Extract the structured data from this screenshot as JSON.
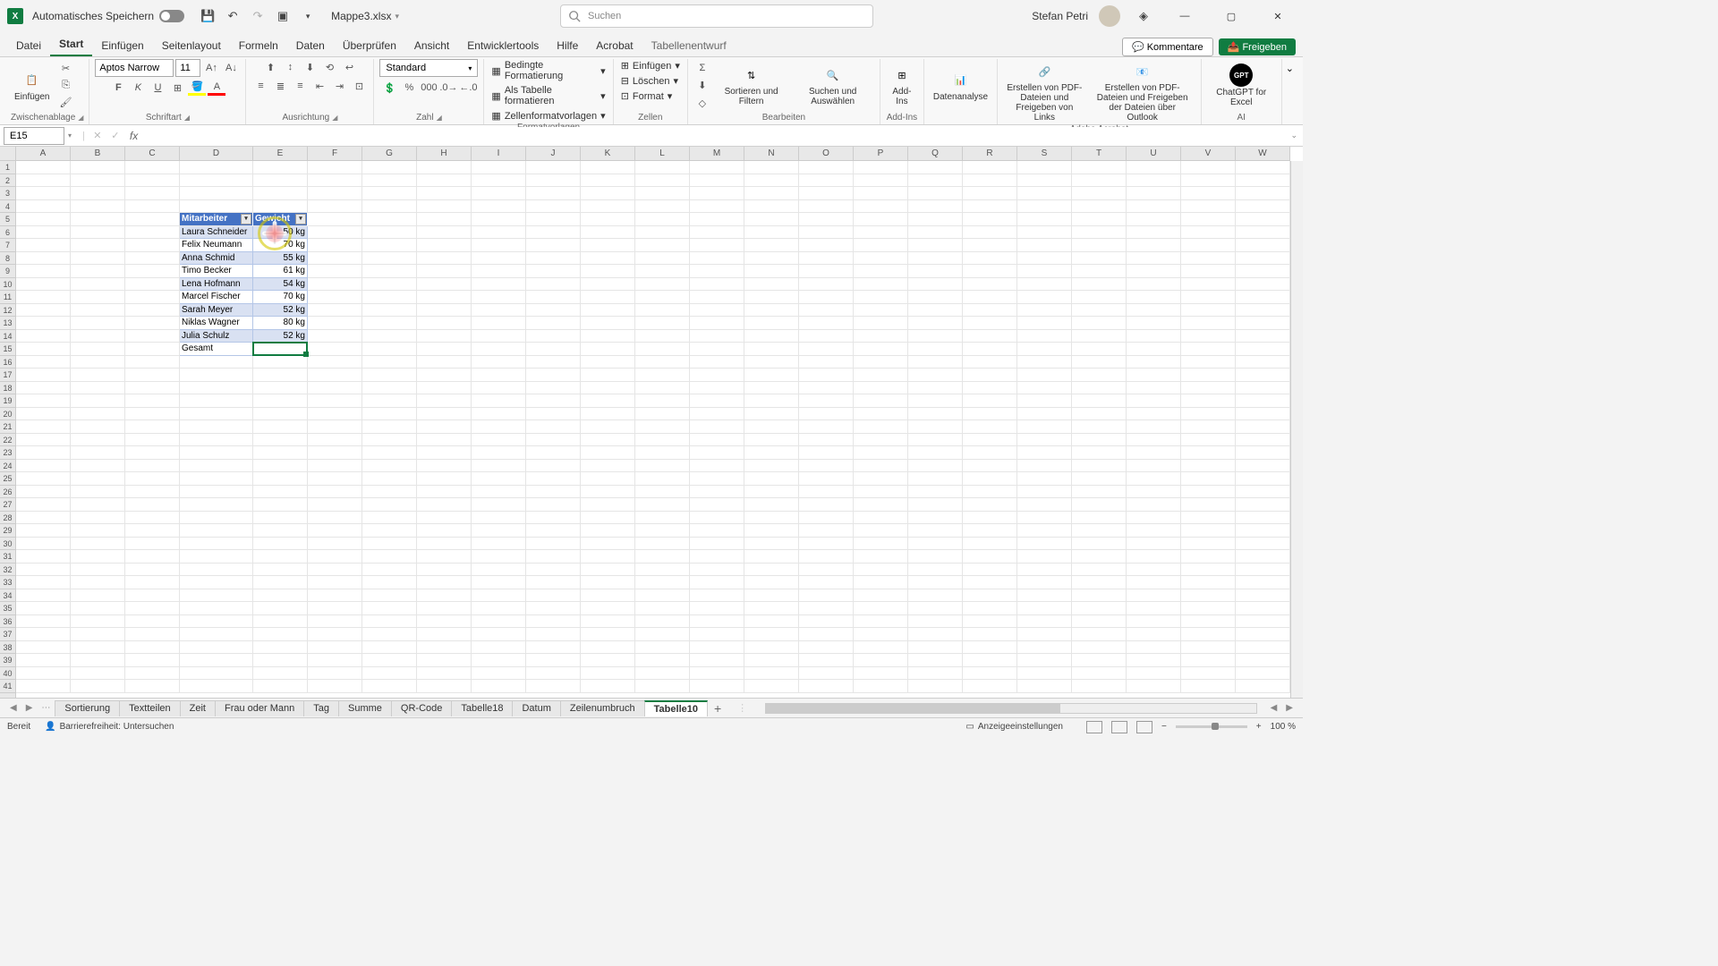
{
  "title": {
    "autosave": "Automatisches Speichern",
    "filename": "Mappe3.xlsx",
    "search_placeholder": "Suchen",
    "username": "Stefan Petri"
  },
  "tabs": {
    "file": "Datei",
    "home": "Start",
    "insert": "Einfügen",
    "layout": "Seitenlayout",
    "formulas": "Formeln",
    "data": "Daten",
    "review": "Überprüfen",
    "view": "Ansicht",
    "dev": "Entwicklertools",
    "help": "Hilfe",
    "acrobat": "Acrobat",
    "table": "Tabellenentwurf",
    "comments": "Kommentare",
    "share": "Freigeben"
  },
  "ribbon": {
    "paste": "Einfügen",
    "clipboard": "Zwischenablage",
    "font_name": "Aptos Narrow",
    "font_size": "11",
    "font": "Schriftart",
    "alignment": "Ausrichtung",
    "number_format": "Standard",
    "number": "Zahl",
    "cond_fmt": "Bedingte Formatierung",
    "as_table": "Als Tabelle formatieren",
    "cell_styles": "Zellenformatvorlagen",
    "styles": "Formatvorlagen",
    "insert_cells": "Einfügen",
    "delete_cells": "Löschen",
    "format_cells": "Format",
    "cells": "Zellen",
    "sort": "Sortieren und Filtern",
    "find": "Suchen und Auswählen",
    "editing": "Bearbeiten",
    "addins": "Add-Ins",
    "addins_grp": "Add-Ins",
    "data_analysis": "Datenanalyse",
    "pdf_links": "Erstellen von PDF-Dateien und Freigeben von Links",
    "pdf_outlook": "Erstellen von PDF-Dateien und Freigeben der Dateien über Outlook",
    "adobe": "Adobe Acrobat",
    "gpt": "ChatGPT for Excel",
    "ai": "AI"
  },
  "namebox": "E15",
  "columns": [
    "A",
    "B",
    "C",
    "D",
    "E",
    "F",
    "G",
    "H",
    "I",
    "J",
    "K",
    "L",
    "M",
    "N",
    "O",
    "P",
    "Q",
    "R",
    "S",
    "T",
    "U",
    "V",
    "W"
  ],
  "rows_count": 41,
  "table": {
    "headers": [
      "Mitarbeiter",
      "Gewicht"
    ],
    "rows": [
      [
        "Laura Schneider",
        "50 kg"
      ],
      [
        "Felix Neumann",
        "70 kg"
      ],
      [
        "Anna Schmid",
        "55 kg"
      ],
      [
        "Timo Becker",
        "61 kg"
      ],
      [
        "Lena Hofmann",
        "54 kg"
      ],
      [
        "Marcel Fischer",
        "70 kg"
      ],
      [
        "Sarah Meyer",
        "52 kg"
      ],
      [
        "Niklas Wagner",
        "80 kg"
      ],
      [
        "Julia Schulz",
        "52 kg"
      ]
    ],
    "total_label": "Gesamt"
  },
  "sheets": [
    "Sortierung",
    "Textteilen",
    "Zeit",
    "Frau oder Mann",
    "Tag",
    "Summe",
    "QR-Code",
    "Tabelle18",
    "Datum",
    "Zeilenumbruch",
    "Tabelle10"
  ],
  "active_sheet": "Tabelle10",
  "status": {
    "ready": "Bereit",
    "accessibility": "Barrierefreiheit: Untersuchen",
    "display_settings": "Anzeigeeinstellungen",
    "zoom": "100 %"
  }
}
